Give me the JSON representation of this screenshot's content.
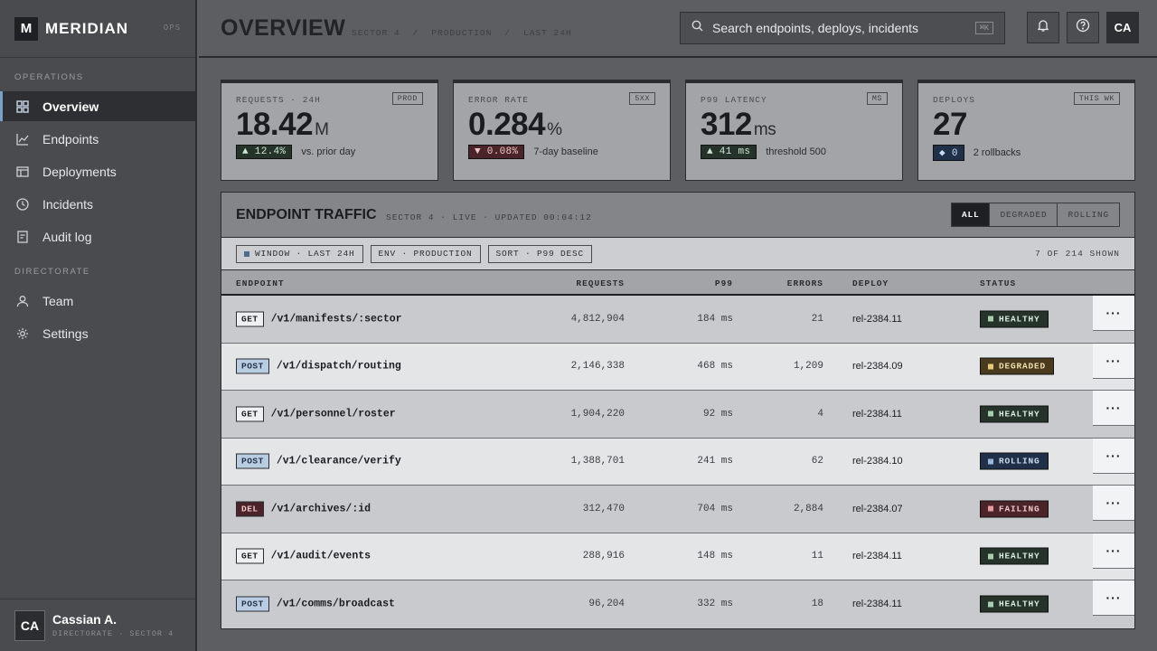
{
  "brand": {
    "logo": "M",
    "name": "MERIDIAN",
    "tag": "OPS"
  },
  "sidebar": {
    "sections": [
      {
        "label": "OPERATIONS",
        "items": [
          {
            "label": "Overview",
            "icon": "grid-icon",
            "active": true
          },
          {
            "label": "Endpoints",
            "icon": "chart-line-icon"
          },
          {
            "label": "Deployments",
            "icon": "layout-icon"
          },
          {
            "label": "Incidents",
            "icon": "clock-icon"
          },
          {
            "label": "Audit log",
            "icon": "list-icon"
          }
        ]
      },
      {
        "label": "DIRECTORATE",
        "items": [
          {
            "label": "Team",
            "icon": "user-icon"
          },
          {
            "label": "Settings",
            "icon": "gear-icon"
          }
        ]
      }
    ]
  },
  "user": {
    "initials": "CA",
    "name": "Cassian A.",
    "role": "DIRECTORATE · SECTOR 4"
  },
  "header": {
    "title": "OVERVIEW",
    "crumbs": [
      "SECTOR 4",
      "/",
      "PRODUCTION",
      "/",
      "LAST 24H"
    ],
    "search_placeholder": "Search endpoints, deploys, incidents",
    "search_shortcut": "⌘K",
    "avatar": "CA"
  },
  "kpis": [
    {
      "label": "REQUESTS · 24H",
      "tag": "PROD",
      "value": "18.42",
      "unit": "M",
      "delta": "▲ 12.4%",
      "delta_kind": "up",
      "note": "vs. prior day"
    },
    {
      "label": "ERROR RATE",
      "tag": "5XX",
      "value": "0.284",
      "unit": "%",
      "delta": "▼ 0.08%",
      "delta_kind": "down",
      "note": "7-day baseline"
    },
    {
      "label": "P99 LATENCY",
      "tag": "MS",
      "value": "312",
      "unit": "ms",
      "delta": "▲ 41 ms",
      "delta_kind": "up",
      "note": "threshold 500"
    },
    {
      "label": "DEPLOYS",
      "tag": "THIS WK",
      "value": "27",
      "unit": "",
      "delta": "◆ 0",
      "delta_kind": "info",
      "note": "2 rollbacks"
    }
  ],
  "panel": {
    "title": "ENDPOINT TRAFFIC",
    "subtitle": "SECTOR 4 · LIVE · UPDATED 00:04:12",
    "filters": [
      "ALL",
      "DEGRADED",
      "ROLLING"
    ],
    "chips": [
      "WINDOW · LAST 24H",
      "ENV · PRODUCTION",
      "SORT · P99 DESC"
    ],
    "shown": "7 OF 214 SHOWN",
    "columns": {
      "endpoint": "ENDPOINT",
      "requests": "REQUESTS",
      "p99": "P99",
      "errors": "ERRORS",
      "deploy": "DEPLOY",
      "status": "STATUS"
    },
    "rows": [
      {
        "method": "GET",
        "path": "/v1/manifests/:sector",
        "requests": "4,812,904",
        "p99": "184 ms",
        "errors": "21",
        "deploy": "rel-2384.11",
        "status": "HEALTHY"
      },
      {
        "method": "POST",
        "path": "/v1/dispatch/routing",
        "requests": "2,146,338",
        "p99": "468 ms",
        "errors": "1,209",
        "deploy": "rel-2384.09",
        "status": "DEGRADED"
      },
      {
        "method": "GET",
        "path": "/v1/personnel/roster",
        "requests": "1,904,220",
        "p99": "92 ms",
        "errors": "4",
        "deploy": "rel-2384.11",
        "status": "HEALTHY"
      },
      {
        "method": "POST",
        "path": "/v1/clearance/verify",
        "requests": "1,388,701",
        "p99": "241 ms",
        "errors": "62",
        "deploy": "rel-2384.10",
        "status": "ROLLING"
      },
      {
        "method": "DEL",
        "path": "/v1/archives/:id",
        "requests": "312,470",
        "p99": "704 ms",
        "errors": "2,884",
        "deploy": "rel-2384.07",
        "status": "FAILING"
      },
      {
        "method": "GET",
        "path": "/v1/audit/events",
        "requests": "288,916",
        "p99": "148 ms",
        "errors": "11",
        "deploy": "rel-2384.11",
        "status": "HEALTHY"
      },
      {
        "method": "POST",
        "path": "/v1/comms/broadcast",
        "requests": "96,204",
        "p99": "332 ms",
        "errors": "18",
        "deploy": "rel-2384.11",
        "status": "HEALTHY"
      }
    ],
    "row_menu": "···"
  }
}
